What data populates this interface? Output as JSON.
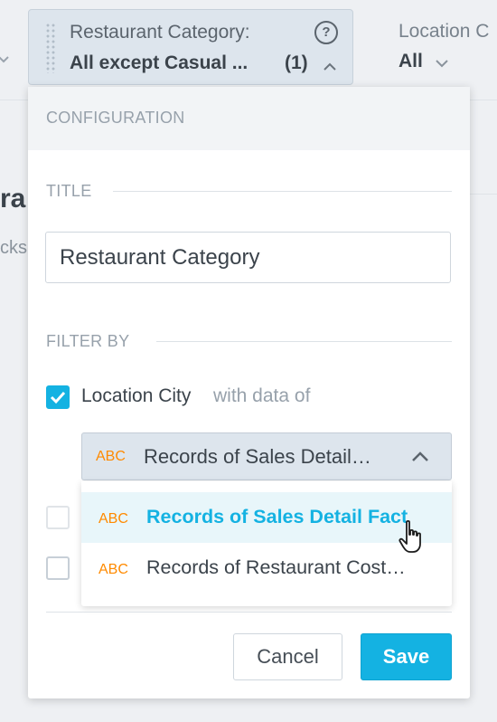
{
  "topbar": {
    "category_filter": {
      "label": "Restaurant Category:",
      "value": "All except Casual ...",
      "count": "(1)"
    },
    "location_filter": {
      "label": "Location C",
      "value": "All"
    }
  },
  "background": {
    "heading_fragment": "ra",
    "text_fragment": "cks"
  },
  "config_panel": {
    "header": "CONFIGURATION",
    "title_section": {
      "label": "TITLE",
      "input_value": "Restaurant Category"
    },
    "filter_section": {
      "label": "FILTER BY",
      "filter_item": {
        "name": "Location City",
        "suffix": "with data of",
        "checked": true
      },
      "dataset_select": {
        "type_tag": "ABC",
        "selected": "Records of Sales Detail…"
      },
      "dataset_options": [
        {
          "type_tag": "ABC",
          "label": "Records of Sales Detail Fact",
          "active": true
        },
        {
          "type_tag": "ABC",
          "label": "Records of Restaurant Cost…",
          "active": false
        }
      ]
    },
    "footer": {
      "cancel_label": "Cancel",
      "save_label": "Save"
    }
  },
  "colors": {
    "accent": "#14b2e2",
    "type_tag": "#ff8a00",
    "panel_header_bg": "#f2f4f6",
    "filter_button_bg": "#dde5ed"
  }
}
